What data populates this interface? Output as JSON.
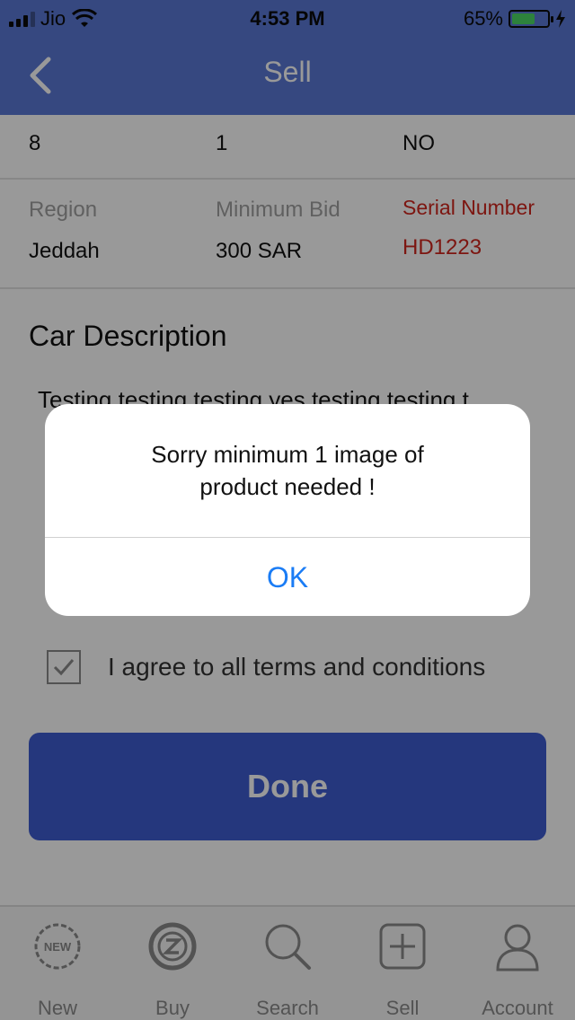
{
  "status_bar": {
    "carrier": "Jio",
    "time": "4:53 PM",
    "battery_percent": "65%",
    "battery_level": 0.65
  },
  "nav": {
    "title": "Sell",
    "back_icon": "chevron-left-icon"
  },
  "top_row": {
    "col1": "8",
    "col2": "1",
    "col3": "NO"
  },
  "details": {
    "region_label": "Region",
    "region_value": "Jeddah",
    "min_bid_label": "Minimum Bid",
    "min_bid_value": "300 SAR",
    "serial_label": "Serial Number",
    "serial_value": "HD1223"
  },
  "description": {
    "title": "Car Description",
    "text": "Testing testing testing yes testing testing t"
  },
  "terms": {
    "label": "I agree to all terms and conditions",
    "checked": true
  },
  "done_button": "Done",
  "tabs": [
    {
      "label": "New",
      "icon": "new-badge-icon"
    },
    {
      "label": "Buy",
      "icon": "buy-z-icon"
    },
    {
      "label": "Search",
      "icon": "search-icon"
    },
    {
      "label": "Sell",
      "icon": "plus-square-icon"
    },
    {
      "label": "Account",
      "icon": "user-icon"
    }
  ],
  "alert": {
    "message_line1": "Sorry minimum 1 image of",
    "message_line2": "product needed !",
    "ok": "OK"
  },
  "colors": {
    "nav_bg": "#5a78d6",
    "primary": "#3f5dd1",
    "serial_red": "#d0261d",
    "alert_link": "#1a7cf5"
  }
}
